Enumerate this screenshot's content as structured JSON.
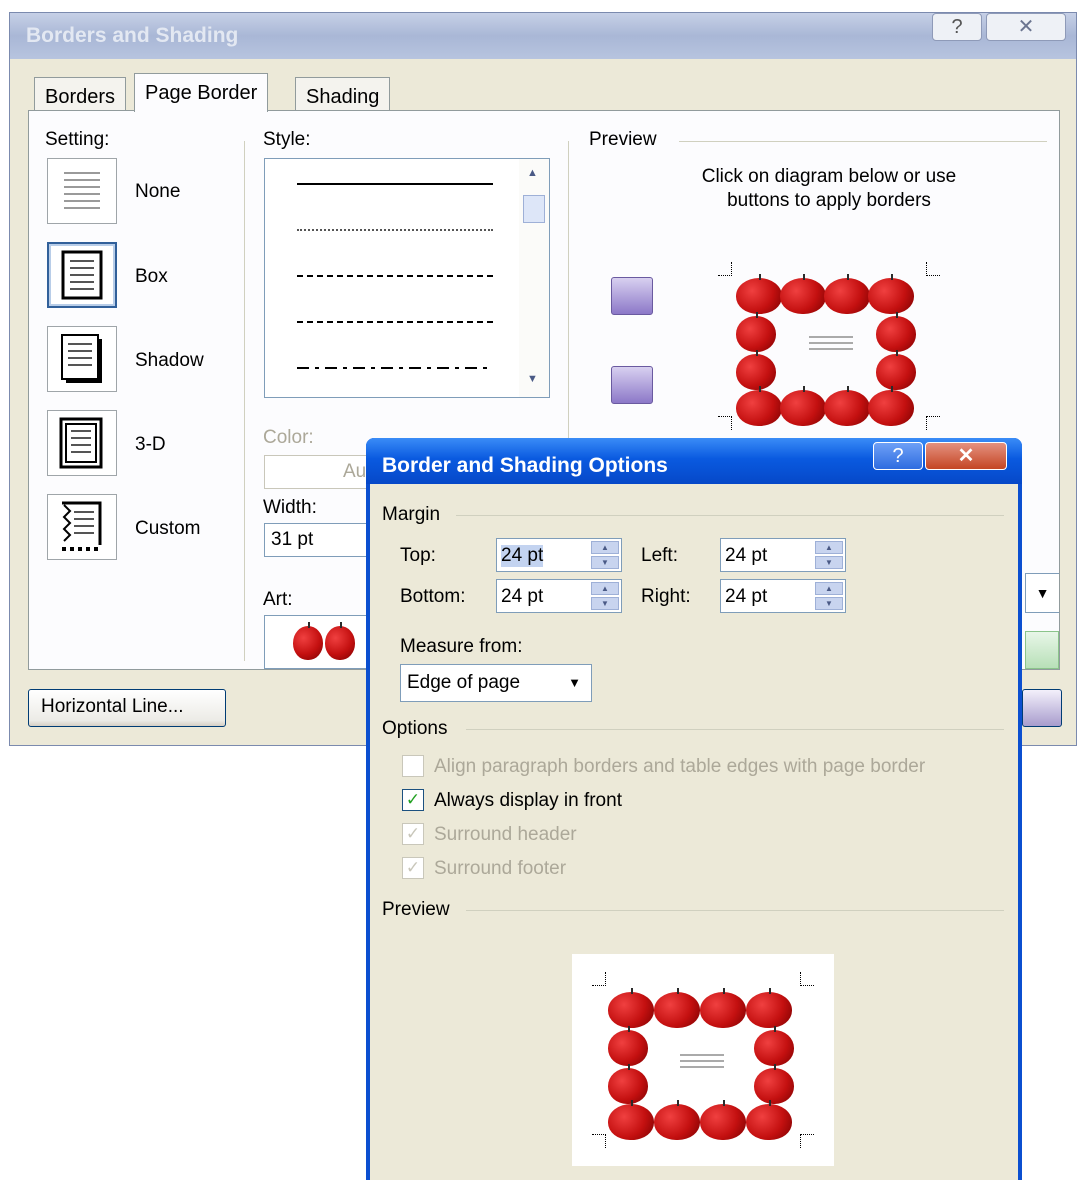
{
  "main_dialog": {
    "title": "Borders and Shading",
    "help": "?",
    "close": "✕",
    "tabs": [
      "Borders",
      "Page Border",
      "Shading"
    ],
    "setting_label": "Setting:",
    "settings": [
      "None",
      "Box",
      "Shadow",
      "3-D",
      "Custom"
    ],
    "style_label": "Style:",
    "color_label": "Color:",
    "color_value": "Au",
    "width_label": "Width:",
    "width_value": "31 pt",
    "art_label": "Art:",
    "preview_label": "Preview",
    "preview_hint": "Click on diagram below or use buttons to apply borders",
    "horizontal_line_button": "Horizontal Line..."
  },
  "options_dialog": {
    "title": "Border and Shading Options",
    "help": "?",
    "close": "✕",
    "margin_label": "Margin",
    "top_label": "Top:",
    "top_value": "24 pt",
    "left_label": "Left:",
    "left_value": "24 pt",
    "bottom_label": "Bottom:",
    "bottom_value": "24 pt",
    "right_label": "Right:",
    "right_value": "24 pt",
    "measure_label": "Measure from:",
    "measure_value": "Edge of page",
    "options_label": "Options",
    "checkboxes": [
      {
        "label": "Align paragraph borders and table edges with page border",
        "checked": false,
        "enabled": false
      },
      {
        "label": "Always display in front",
        "checked": true,
        "enabled": true
      },
      {
        "label": "Surround header",
        "checked": true,
        "enabled": false
      },
      {
        "label": "Surround footer",
        "checked": true,
        "enabled": false
      }
    ],
    "preview_label": "Preview"
  },
  "colors": {
    "dialog_bg": "#ece9d8",
    "options_title": "#0a5ae0",
    "apple": "#c41010"
  }
}
